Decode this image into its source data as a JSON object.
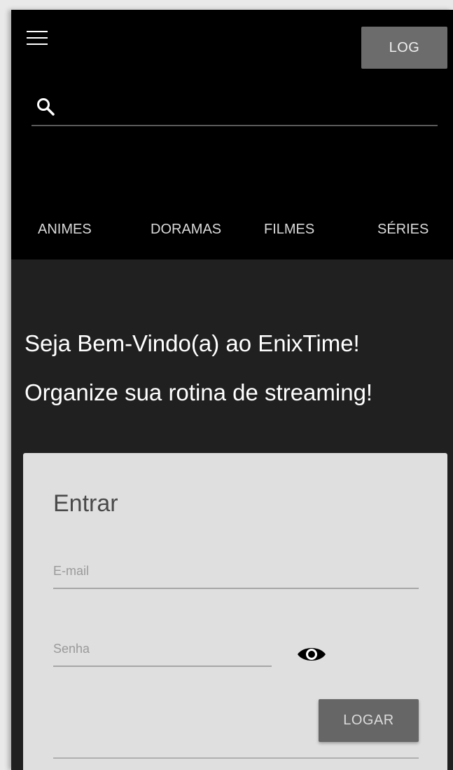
{
  "header": {
    "menu_icon": "hamburger-menu-icon",
    "log_button_label": "LOG",
    "search": {
      "icon": "search-icon",
      "value": "",
      "placeholder": ""
    },
    "tabs": [
      {
        "label": "ANIMES"
      },
      {
        "label": "DORAMAS"
      },
      {
        "label": "FILMES"
      },
      {
        "label": "SÉRIES"
      }
    ]
  },
  "main": {
    "welcome_text": "Seja Bem-Vindo(a) ao EnixTime!",
    "slogan_text": "Organize sua rotina de streaming!"
  },
  "login_card": {
    "title": "Entrar",
    "email": {
      "placeholder": "E-mail",
      "value": ""
    },
    "password": {
      "placeholder": "Senha",
      "value": ""
    },
    "toggle_visibility_icon": "eye-icon",
    "submit_label": "LOGAR"
  },
  "colors": {
    "header_bg": "#000000",
    "page_bg": "#202020",
    "card_bg": "#dfdfdf",
    "button_bg": "#6c6c6c"
  }
}
